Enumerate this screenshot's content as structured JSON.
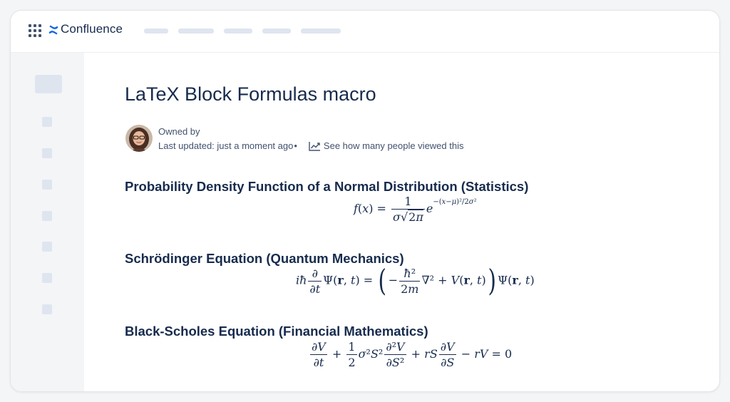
{
  "header": {
    "brand": "Confluence",
    "apps_icon": "app-switcher-grid-icon",
    "logo_icon": "confluence-logo-icon",
    "accent_color": "#0c66e4"
  },
  "page": {
    "title": "LaTeX Block Formulas macro",
    "owned_by": "Owned by",
    "last_updated": "Last updated: just a moment ago",
    "separator": "•",
    "analytics_icon": "chart-line-icon",
    "analytics_link": "See how many people viewed this"
  },
  "sections": [
    {
      "heading": "Probability Density Function of a Normal Distribution (Statistics)",
      "formula": "f(x) = \\frac{1}{\\sigma\\sqrt{2\\pi}} e^{-\\frac{(x-\\mu)^2}{2\\sigma^2}}"
    },
    {
      "heading": "Schrödinger Equation (Quantum Mechanics)",
      "formula": "i\\hbar\\frac{\\partial}{\\partial t}\\Psi(\\mathbf{r},t) = \\left(-\\frac{\\hbar^2}{2m}\\nabla^2 + V(\\mathbf{r},t)\\right)\\Psi(\\mathbf{r},t)"
    },
    {
      "heading": "Black-Scholes Equation (Financial Mathematics)",
      "formula": "\\frac{\\partial V}{\\partial t} + \\frac{1}{2}\\sigma^2 S^2 \\frac{\\partial^2 V}{\\partial S^2} + rS\\frac{\\partial V}{\\partial S} - rV = 0"
    }
  ]
}
